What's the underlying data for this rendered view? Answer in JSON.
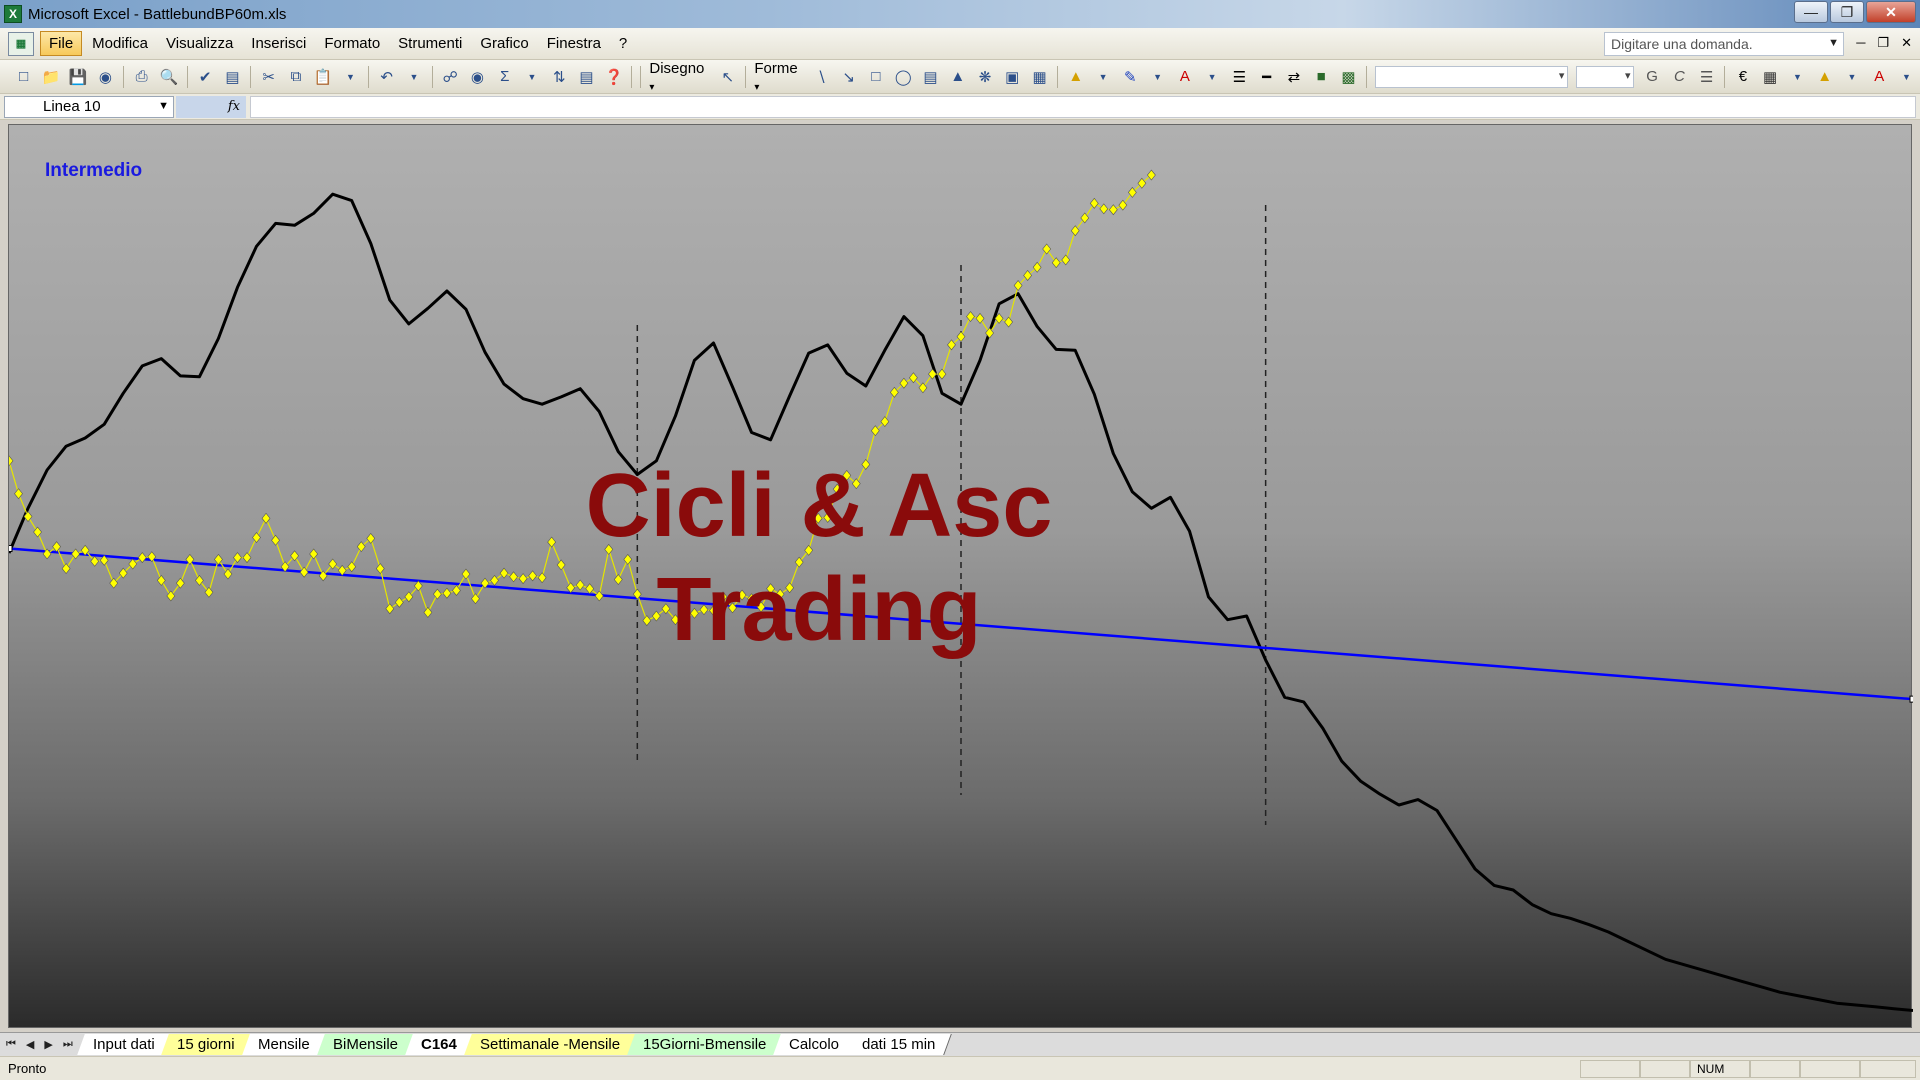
{
  "window": {
    "title": "Microsoft Excel - BattlebundBP60m.xls",
    "app_icon": "X"
  },
  "menu": [
    {
      "label": "File",
      "active": true
    },
    {
      "label": "Modifica"
    },
    {
      "label": "Visualizza"
    },
    {
      "label": "Inserisci"
    },
    {
      "label": "Formato"
    },
    {
      "label": "Strumenti"
    },
    {
      "label": "Grafico"
    },
    {
      "label": "Finestra"
    },
    {
      "label": "?"
    }
  ],
  "help": {
    "placeholder": "Digitare una domanda."
  },
  "toolbar": {
    "drawing_label": "Disegno",
    "shapes_label": "Forme"
  },
  "formulabar": {
    "namebox": "Linea 10",
    "fx": "fx"
  },
  "chart": {
    "title": "Intermedio",
    "watermark_line1": "Cicli & Asc",
    "watermark_line2": "Trading"
  },
  "chart_data": {
    "type": "line",
    "title": "Intermedio",
    "xlabel": "",
    "ylabel": "",
    "series": [
      {
        "color": "#ffff00",
        "marker": "diamond",
        "x": [
          0,
          10,
          20,
          30,
          40,
          50,
          60,
          70,
          80,
          90,
          100,
          110,
          120,
          130,
          140,
          150,
          160,
          170,
          180,
          190,
          200,
          210,
          220,
          230,
          240,
          250,
          260,
          270,
          280,
          290,
          300,
          310,
          320,
          330,
          340,
          350,
          360,
          370,
          380,
          390,
          400,
          410,
          420,
          430,
          440,
          450,
          460,
          470,
          480,
          490,
          500,
          510,
          520,
          530,
          540,
          550,
          560,
          570,
          580,
          590,
          600,
          610,
          620,
          630,
          640,
          650,
          660,
          670,
          680,
          690,
          700,
          710,
          720,
          730,
          740,
          750,
          760,
          770,
          780,
          790,
          800,
          810,
          820,
          830,
          840,
          850,
          860,
          870,
          880,
          890,
          900,
          910,
          920,
          930,
          940,
          950,
          960,
          970,
          980,
          990,
          1000,
          1010,
          1020,
          1030,
          1040,
          1050,
          1060,
          1070,
          1080,
          1090,
          1100,
          1110,
          1120,
          1130,
          1140,
          1150,
          1160,
          1170,
          1180,
          1190,
          1200
        ],
        "values": [
          96,
          60,
          35,
          18,
          -6,
          2,
          -22,
          -6,
          -2,
          -14,
          -13,
          -38,
          -27,
          -17,
          -10,
          -9,
          -35,
          -52,
          -38,
          -12,
          -35,
          -48,
          -12,
          -28,
          -10,
          -10,
          12,
          33,
          9,
          -20,
          -8,
          -26,
          -6,
          -30,
          -17,
          -24,
          -20,
          2,
          11,
          -22,
          -66,
          -59,
          -53,
          -41,
          -70,
          -50,
          -49,
          -46,
          -28,
          -55,
          -38,
          -35,
          -27,
          -31,
          -33,
          -30,
          -32,
          7,
          -18,
          -43,
          -40,
          -44,
          -52,
          -1,
          -34,
          -12,
          -50,
          -79,
          -74,
          -66,
          -78,
          -76,
          -71,
          -67,
          -68,
          -53,
          -65,
          -51,
          -55,
          -64,
          -44,
          -50,
          -43,
          -15,
          -2,
          33,
          34,
          65,
          80,
          71,
          92,
          129,
          139,
          171,
          181,
          187,
          176,
          191,
          191,
          223,
          232,
          254,
          252,
          236,
          252,
          248,
          288,
          299,
          308,
          328,
          313,
          316,
          348,
          362,
          378,
          372,
          371,
          376,
          390,
          400,
          409
        ]
      },
      {
        "color": "#000000",
        "name": "",
        "x": [
          0,
          20,
          40,
          60,
          80,
          100,
          120,
          140,
          160,
          180,
          200,
          220,
          240,
          260,
          280,
          300,
          320,
          340,
          360,
          380,
          400,
          420,
          440,
          460,
          480,
          500,
          520,
          540,
          560,
          580,
          600,
          620,
          640,
          660,
          680,
          700,
          720,
          740,
          760,
          780,
          800,
          820,
          840,
          860,
          880,
          900,
          920,
          940,
          960,
          980,
          1000,
          1020,
          1040,
          1060,
          1080,
          1100,
          1120,
          1140,
          1160,
          1180,
          1200,
          1220,
          1240,
          1260,
          1280,
          1300,
          1320,
          1340,
          1360,
          1380,
          1400,
          1420,
          1440,
          1460,
          1480,
          1500,
          1520,
          1540,
          1560,
          1580,
          1600,
          1620,
          1640,
          1660,
          1680,
          1700,
          1720,
          1740,
          1760,
          1780,
          1800,
          1820,
          1840,
          1860,
          1880,
          1900,
          1920,
          1940,
          1960,
          1980,
          2000
        ],
        "values": [
          -5,
          44,
          86,
          112,
          121,
          136,
          170,
          200,
          208,
          189,
          188,
          230,
          286,
          331,
          356,
          354,
          367,
          388,
          381,
          334,
          272,
          246,
          263,
          282,
          262,
          215,
          180,
          164,
          158,
          166,
          175,
          150,
          106,
          81,
          96,
          145,
          206,
          225,
          177,
          127,
          119,
          167,
          214,
          223,
          192,
          178,
          217,
          254,
          233,
          170,
          158,
          206,
          268,
          279,
          243,
          218,
          217,
          169,
          104,
          62,
          44,
          56,
          19,
          -53,
          -78,
          -74,
          -122,
          -163,
          -168,
          -197,
          -233,
          -255,
          -269,
          -281,
          -275,
          -287,
          -319,
          -351,
          -369,
          -374,
          -390,
          -400,
          -405,
          -412,
          -420,
          -430,
          -440,
          -450,
          -456,
          -462,
          -468,
          -474,
          -480,
          -486,
          -490,
          -494,
          -498,
          -500,
          -502,
          -504,
          -506
        ]
      },
      {
        "color": "#0000ff",
        "name": "",
        "x": [
          0,
          2000
        ],
        "values": [
          0,
          -165
        ]
      }
    ],
    "ylim": [
      -500,
      420
    ],
    "xlim": [
      0,
      2000
    ],
    "grid": false,
    "vertical_markers": [
      660,
      1000,
      1320
    ]
  },
  "sheets": [
    {
      "label": "Input dati",
      "color": "white"
    },
    {
      "label": "15 giorni",
      "color": "yellow"
    },
    {
      "label": "Mensile",
      "color": "white"
    },
    {
      "label": "BiMensile",
      "color": "green"
    },
    {
      "label": "C164",
      "color": "white",
      "active": true
    },
    {
      "label": "Settimanale -Mensile",
      "color": "yellow"
    },
    {
      "label": "15Giorni-Bmensile",
      "color": "green"
    },
    {
      "label": "Calcolo",
      "color": "white"
    },
    {
      "label": "dati 15 min",
      "color": "white"
    }
  ],
  "status": {
    "text": "Pronto",
    "num": "NUM"
  }
}
